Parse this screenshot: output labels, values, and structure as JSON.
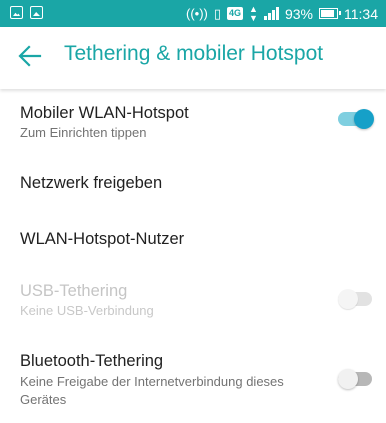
{
  "status_bar": {
    "network_type": "4G",
    "battery_percent": "93%",
    "time": "11:34",
    "icons": [
      "image-notification-icon",
      "photo-notification-icon",
      "hotspot-icon",
      "vibrate-icon",
      "lte-icon",
      "data-arrows-icon",
      "signal-icon",
      "battery-icon"
    ]
  },
  "app_bar": {
    "title": "Tethering & mobiler Hotspot",
    "accent_color": "#1aa6a6"
  },
  "settings": [
    {
      "title": "Mobiler WLAN-Hotspot",
      "subtitle": "Zum Einrichten tippen",
      "toggle": "on",
      "enabled": true
    },
    {
      "title": "Netzwerk freigeben",
      "enabled": true
    },
    {
      "title": "WLAN-Hotspot-Nutzer",
      "enabled": true
    },
    {
      "title": "USB-Tethering",
      "subtitle": "Keine USB-Verbindung",
      "toggle": "off",
      "enabled": false
    },
    {
      "title": "Bluetooth-Tethering",
      "subtitle": "Keine Freigabe der Internetverbindung dieses Gerätes",
      "toggle": "off",
      "enabled": true
    }
  ]
}
